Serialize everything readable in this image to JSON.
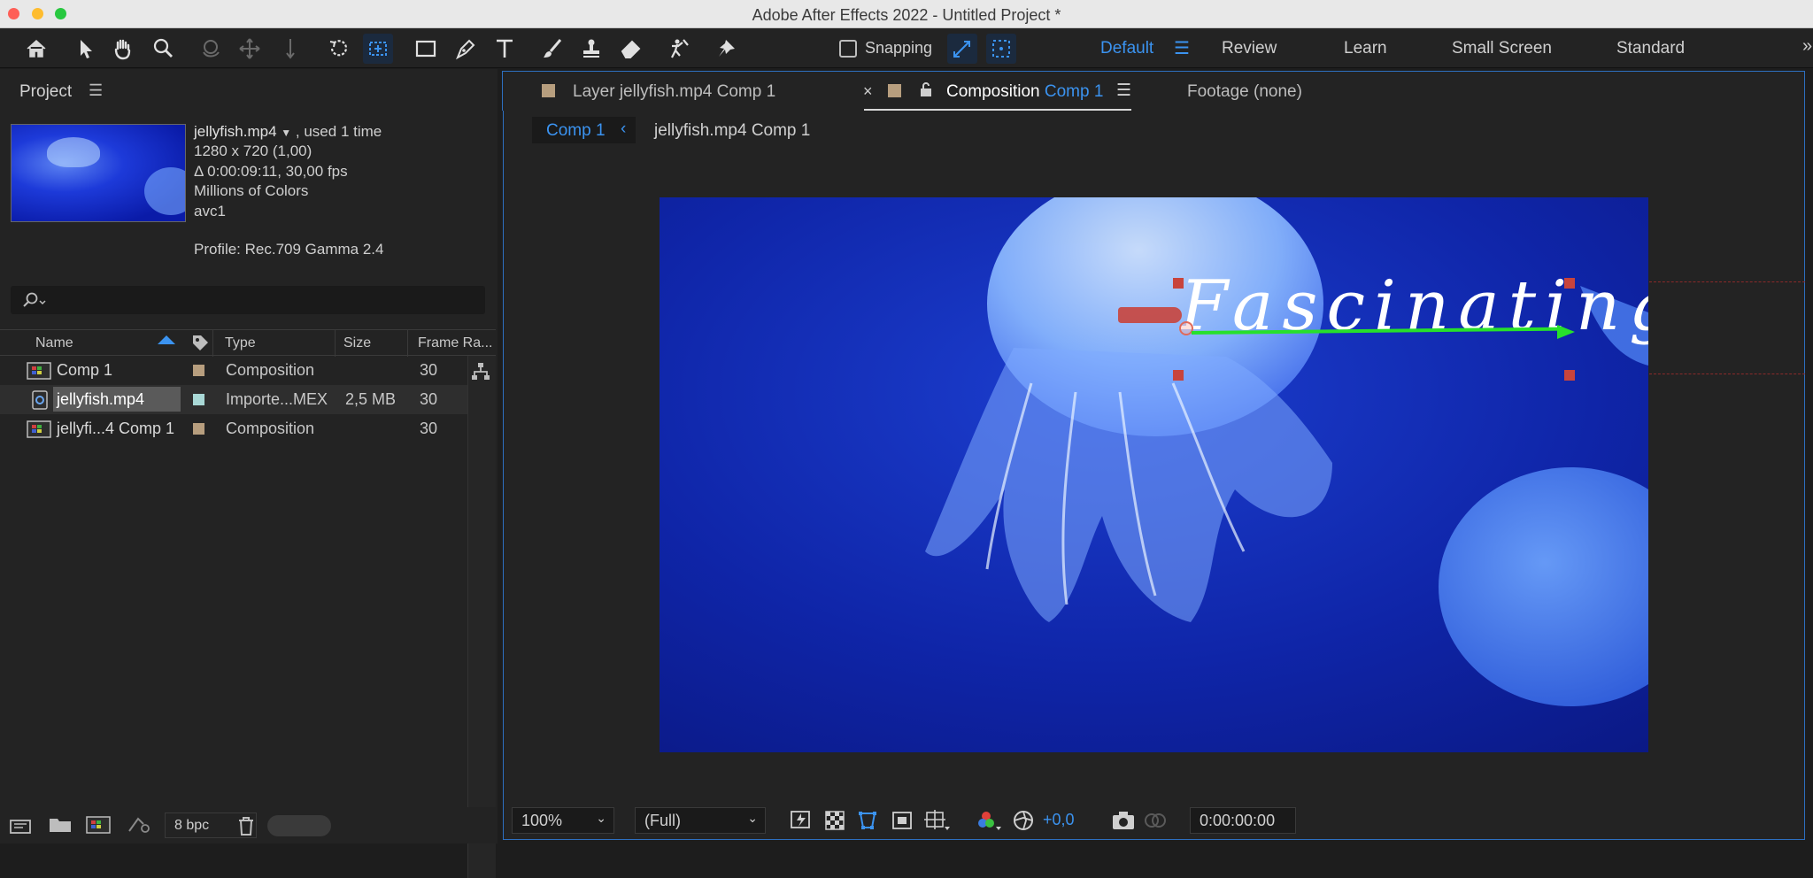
{
  "window": {
    "title": "Adobe After Effects 2022 - Untitled Project *"
  },
  "toolbar": {
    "snapping_label": "Snapping"
  },
  "workspaces": [
    "Default",
    "Review",
    "Learn",
    "Small Screen",
    "Standard"
  ],
  "project_panel": {
    "title": "Project",
    "selected_item": {
      "name": "jellyfish.mp4",
      "usage": ", used 1 time",
      "dimensions": "1280 x 720 (1,00)",
      "duration": "Δ 0:00:09:11, 30,00 fps",
      "colors": "Millions of Colors",
      "codec": "avc1",
      "profile": "Profile: Rec.709 Gamma 2.4"
    },
    "search_placeholder": "",
    "columns": [
      "Name",
      "Type",
      "Size",
      "Frame Ra..."
    ],
    "items": [
      {
        "name": "Comp 1",
        "type": "Composition",
        "size": "",
        "frame_rate": "30",
        "label_color": "#b79e7e"
      },
      {
        "name": "jellyfish.mp4",
        "type": "Importe...MEX",
        "size": "2,5 MB",
        "frame_rate": "30",
        "label_color": "#a9d8d6"
      },
      {
        "name": "jellyfi...4 Comp 1",
        "type": "Composition",
        "size": "",
        "frame_rate": "30",
        "label_color": "#b79e7e"
      }
    ],
    "bit_depth": "8 bpc"
  },
  "viewer_tabs": {
    "layer_tab_prefix": "Layer",
    "layer_tab_name": "jellyfish.mp4 Comp 1",
    "comp_tab_prefix": "Composition",
    "comp_tab_name": "Comp 1",
    "footage_tab": "Footage (none)"
  },
  "breadcrumbs": [
    "Comp 1",
    "jellyfish.mp4 Comp 1"
  ],
  "canvas": {
    "overlay_text": "Fascinating W"
  },
  "viewer_bar": {
    "zoom": "100%",
    "resolution": "(Full)",
    "exposure": "+0,0",
    "timecode": "0:00:00:00"
  },
  "colors": {
    "accent": "#2d8ceb",
    "motion_arrow": "#27e02b",
    "handle": "#c8443c"
  }
}
